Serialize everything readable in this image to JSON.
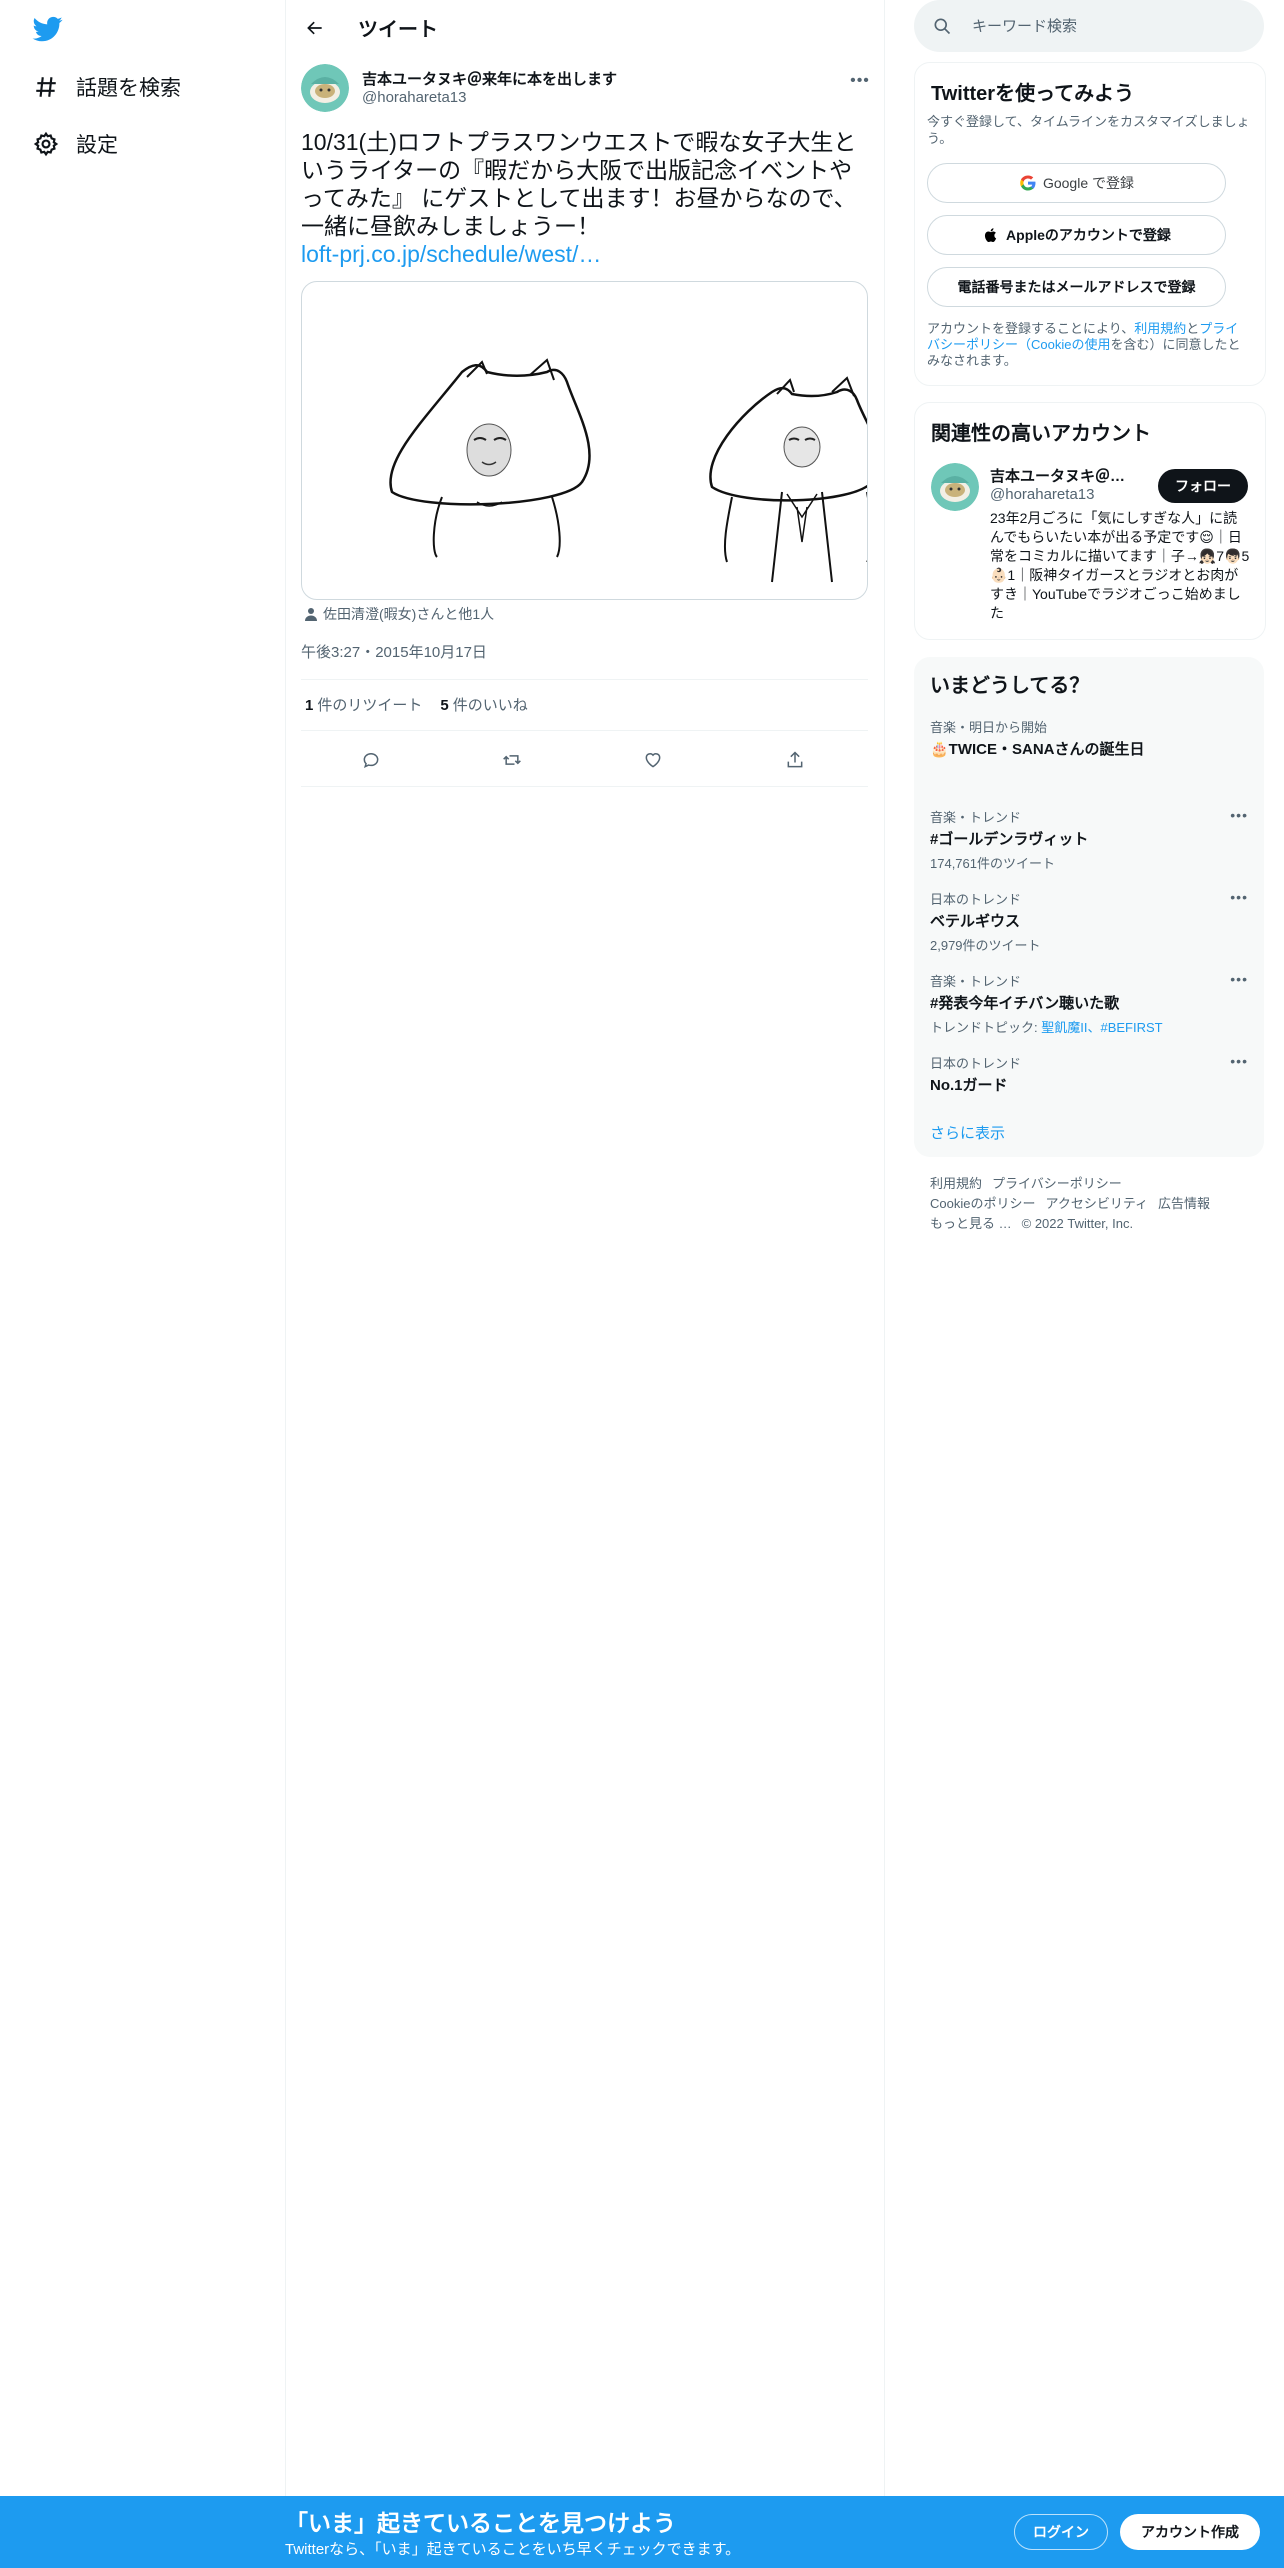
{
  "nav": {
    "logo_icon": "twitter-bird-icon",
    "items": [
      {
        "label": "話題を検索",
        "icon": "hashtag-icon"
      },
      {
        "label": "設定",
        "icon": "gear-icon"
      }
    ]
  },
  "header": {
    "title": "ツイート"
  },
  "tweet": {
    "author_name": "吉本ユータヌキ＠来年に本を出します",
    "author_handle": "@horahareta13",
    "text": "10/31(土)ロフトプラスワンウエストで暇な女子大生というライターの『暇だから大阪で出版記念イベントやってみた』 にゲストとして出ます！お昼からなので、一緒に昼飲みしましょうー！",
    "link": "loft-prj.co.jp/schedule/west/…",
    "tagged": "佐田清澄(暇女)さんと他1人",
    "timestamp": "午後3:27・2015年10月17日",
    "retweets_count": "1",
    "retweets_label": "件のリツイート",
    "likes_count": "5",
    "likes_label": "件のいいね"
  },
  "search": {
    "placeholder": "キーワード検索"
  },
  "signup": {
    "title": "Twitterを使ってみよう",
    "subtitle": "今すぐ登録して、タイムラインをカスタマイズしましょう。",
    "google_label": "Google で登録",
    "apple_label": "Appleのアカウントで登録",
    "phone_label": "電話番号またはメールアドレスで登録",
    "legal_prefix": "アカウントを登録することにより、",
    "legal_terms": "利用規約",
    "legal_and": "と",
    "legal_privacy": "プライバシーポリシー（Cookieの使用",
    "legal_suffix": "を含む）に同意したとみなされます。"
  },
  "related": {
    "title": "関連性の高いアカウント",
    "name": "吉本ユータヌキ＠来年に本を出します",
    "handle": "@horahareta13",
    "follow_label": "フォロー",
    "bio": "23年2月ごろに「気にしすぎな人」に読んでもらいたい本が出る予定です😌｜日常をコミカルに描いてます｜子→👧🏻7👦🏻5👶🏻1｜阪神タイガースとラジオとお肉がすき｜YouTubeでラジオごっこ始めました"
  },
  "trends": {
    "title": "いまどうしてる？",
    "items": [
      {
        "meta": "音楽・明日から開始",
        "name": "🎂TWICE・SANAさんの誕生日",
        "count": ""
      },
      {
        "meta": "音楽・トレンド",
        "name": "#ゴールデンラヴィット",
        "count": "174,761件のツイート"
      },
      {
        "meta": "日本のトレンド",
        "name": "ベテルギウス",
        "count": "2,979件のツイート"
      },
      {
        "meta": "音楽・トレンド",
        "name": "#発表今年イチバン聴いた歌",
        "count_prefix": "トレンドトピック: ",
        "count_links": "聖飢魔II、#BEFIRST"
      },
      {
        "meta": "日本のトレンド",
        "name": "No.1ガード",
        "count": ""
      }
    ],
    "show_more": "さらに表示",
    "more_icon": "ellipsis-icon"
  },
  "footer": {
    "terms": "利用規約",
    "privacy": "プライバシーポリシー",
    "cookie": "Cookieのポリシー",
    "accessibility": "アクセシビリティ",
    "ads": "広告情報",
    "more": "もっと見る …",
    "copyright": "© 2022 Twitter, Inc."
  },
  "bottom_bar": {
    "title": "「いま」起きていることを見つけよう",
    "subtitle": "Twitterなら、「いま」起きていることをいち早くチェックできます。",
    "login_label": "ログイン",
    "signup_label": "アカウント作成"
  },
  "colors": {
    "accent": "#1d9bf0",
    "text": "#0f1419",
    "muted": "#536471"
  }
}
